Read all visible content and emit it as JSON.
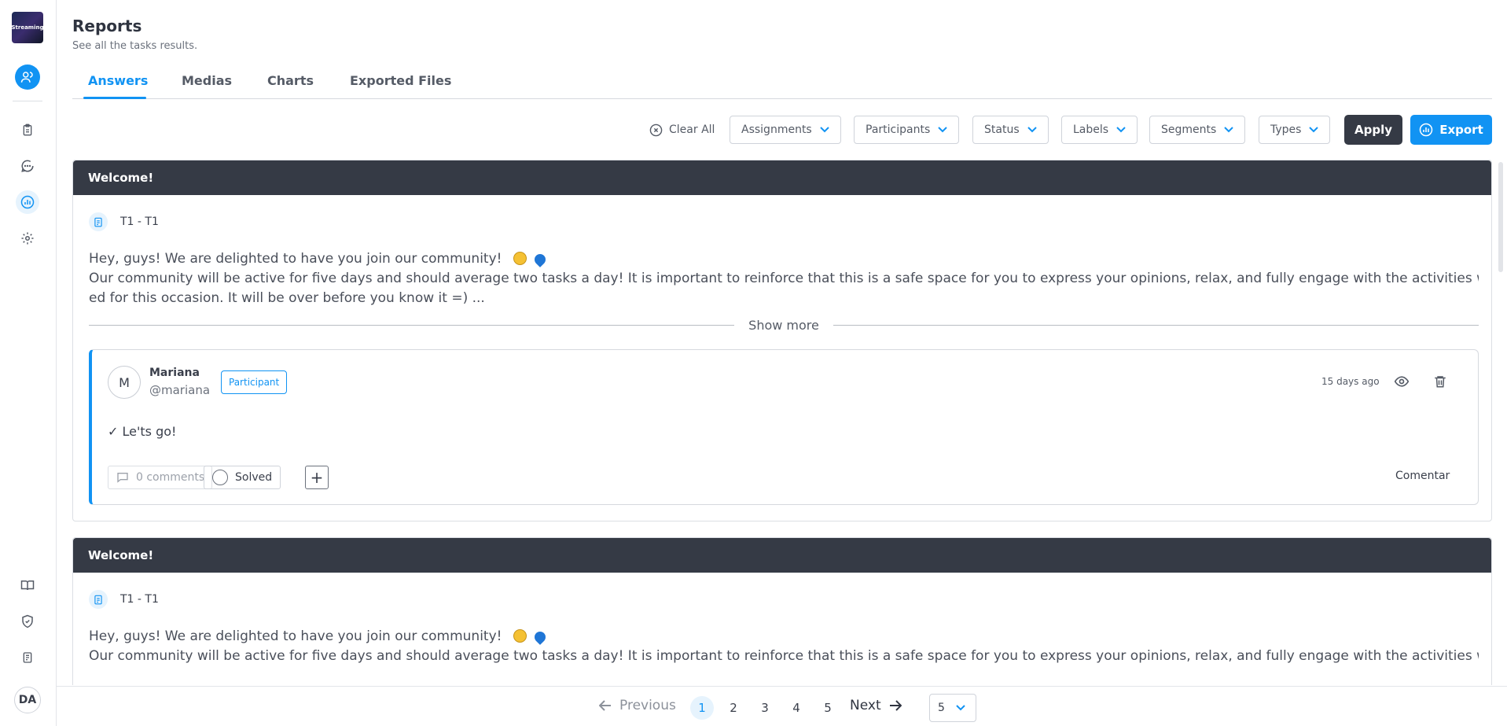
{
  "sidebar": {
    "logo_text": "Streaming",
    "avatar_initials": "DA"
  },
  "header": {
    "title": "Reports",
    "subtitle": "See all the tasks results."
  },
  "tabs": [
    {
      "label": "Answers",
      "active": true
    },
    {
      "label": "Medias",
      "active": false
    },
    {
      "label": "Charts",
      "active": false
    },
    {
      "label": "Exported Files",
      "active": false
    }
  ],
  "filters": {
    "clear_all": "Clear All",
    "items": [
      "Assignments",
      "Participants",
      "Status",
      "Labels",
      "Segments",
      "Types"
    ],
    "apply": "Apply",
    "export": "Export"
  },
  "cards": [
    {
      "title": "Welcome!",
      "task": "T1 - T1",
      "text_line1": "Hey, guys! We are delighted to have you join our community!",
      "text_line2": "Our community will be active for five days and should average two tasks a day! It is important to reinforce that this is a safe space for you to express your opinions, relax, and fully engage with the activities we have design",
      "text_line3": "ed for this occasion. It will be over before you know it =)  ...",
      "show_more": "Show more",
      "answer": {
        "avatar_initial": "M",
        "name": "Mariana",
        "handle": "@mariana",
        "role": "Participant",
        "time": "15 days ago",
        "text": "✓  Le'ts go!",
        "comments": "0 comments",
        "solved": "Solved",
        "plus": "+",
        "comment_action": "Comentar"
      }
    },
    {
      "title": "Welcome!",
      "task": "T1 - T1",
      "text_line1": "Hey, guys! We are delighted to have you join our community!",
      "text_line2": "Our community will be active for five days and should average two tasks a day! It is important to reinforce that this is a safe space for you to express your opinions, relax, and fully engage with the activities we have design"
    }
  ],
  "pagination": {
    "previous": "Previous",
    "pages": [
      "1",
      "2",
      "3",
      "4",
      "5"
    ],
    "current": "1",
    "next": "Next",
    "page_size": "5"
  },
  "colors": {
    "accent": "#1193f3",
    "dark": "#353a45"
  }
}
